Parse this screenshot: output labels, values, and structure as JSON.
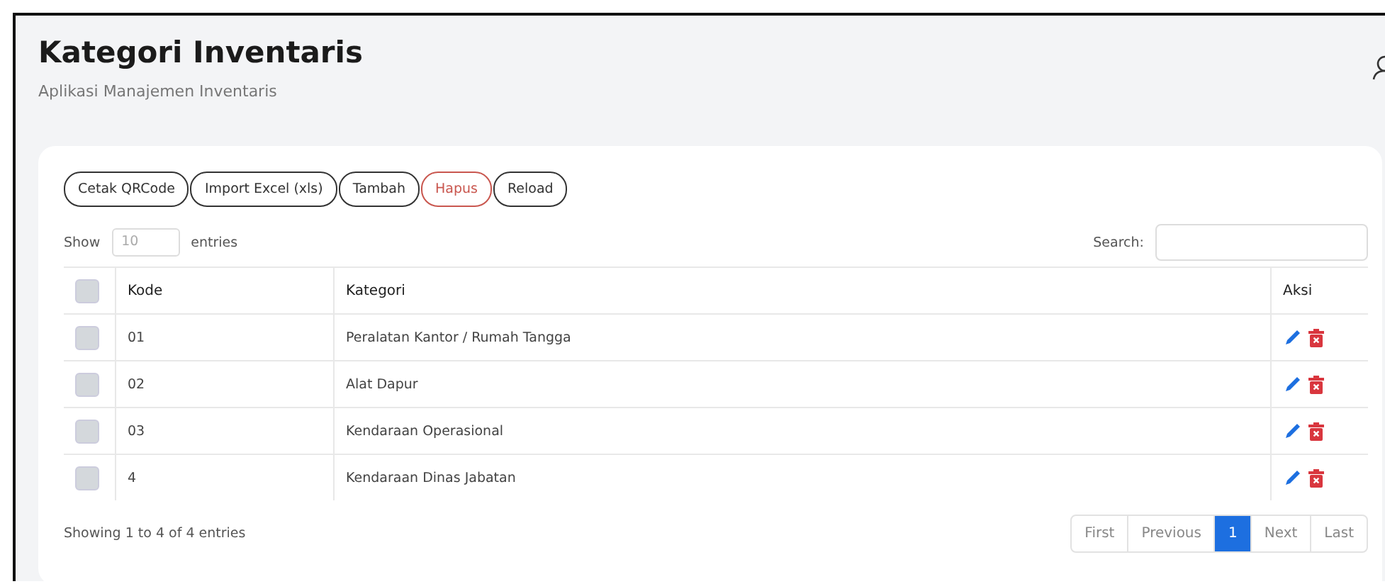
{
  "header": {
    "title": "Kategori Inventaris",
    "subtitle": "Aplikasi Manajemen Inventaris"
  },
  "toolbar": [
    {
      "label": "Cetak QRCode",
      "kind": "default"
    },
    {
      "label": "Import Excel (xls)",
      "kind": "default"
    },
    {
      "label": "Tambah",
      "kind": "default"
    },
    {
      "label": "Hapus",
      "kind": "danger"
    },
    {
      "label": "Reload",
      "kind": "default"
    }
  ],
  "length": {
    "before": "Show",
    "value": "10",
    "after": "entries"
  },
  "search": {
    "label": "Search:"
  },
  "table": {
    "select_all": {
      "checked": false
    },
    "columns": [
      "Kode",
      "Kategori",
      "Aksi"
    ],
    "rows": [
      {
        "checked": false,
        "kode": "01",
        "kategori": "Peralatan Kantor / Rumah Tangga"
      },
      {
        "checked": false,
        "kode": "02",
        "kategori": "Alat Dapur"
      },
      {
        "checked": false,
        "kode": "03",
        "kategori": "Kendaraan Operasional"
      },
      {
        "checked": false,
        "kode": "4",
        "kategori": "Kendaraan Dinas Jabatan"
      }
    ]
  },
  "info": "Showing 1 to 4 of 4 entries",
  "pagination": [
    {
      "label": "First",
      "selected": false
    },
    {
      "label": "Previous",
      "selected": false
    },
    {
      "label": "1",
      "selected": true
    },
    {
      "label": "Next",
      "selected": false
    },
    {
      "label": "Last",
      "selected": false
    }
  ]
}
